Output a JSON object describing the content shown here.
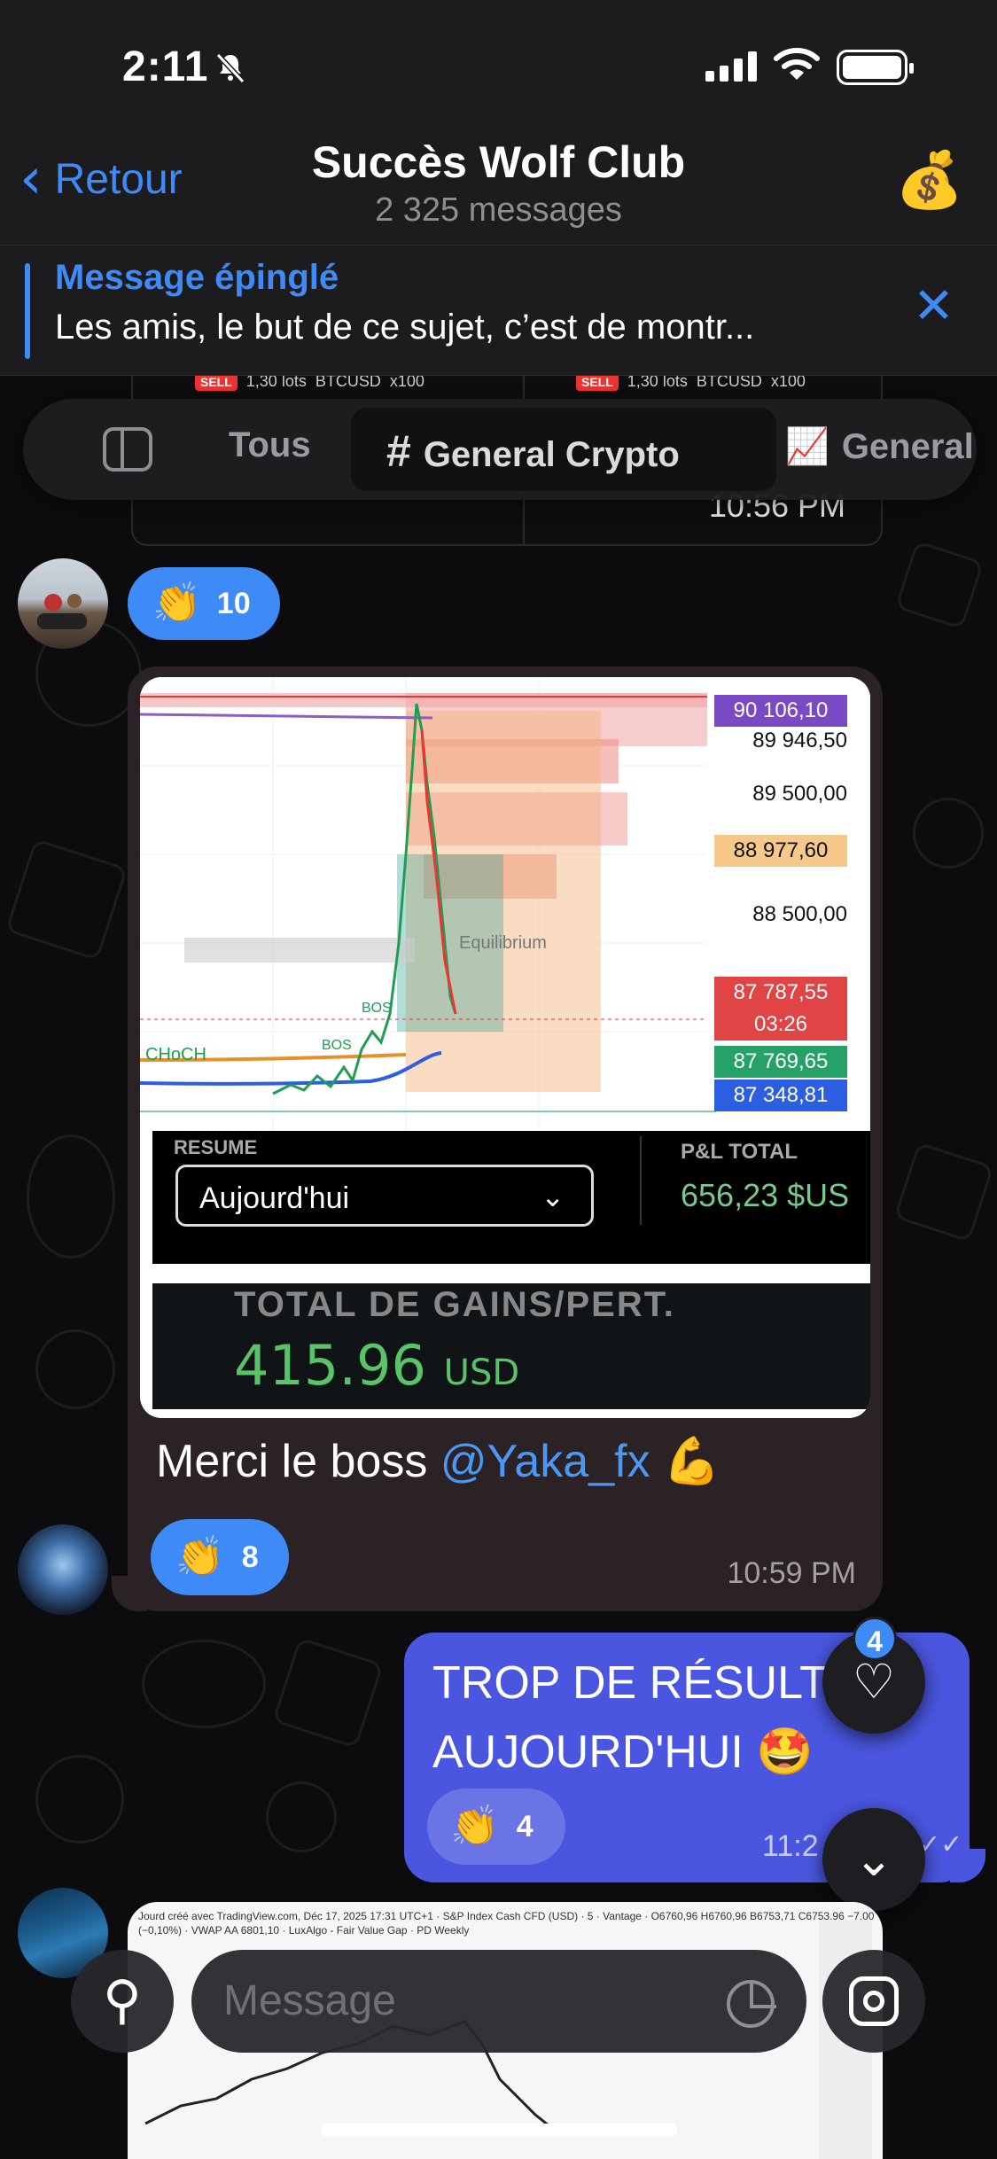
{
  "status": {
    "time": "2:11"
  },
  "header": {
    "back_label": "Retour",
    "title": "Succès Wolf Club",
    "subtitle": "2 325 messages",
    "avatar_icon": "money-bag-icon"
  },
  "pinned": {
    "title": "Message épinglé",
    "text": "Les amis, le but de ce sujet, c’est de montr..."
  },
  "top_strip": {
    "sell_badge": "SELL",
    "lots": "1,30 lots",
    "symbol": "BTCUSD",
    "leverage": "x100",
    "time": "10:56 PM"
  },
  "topics": {
    "items": [
      {
        "label": "Tous",
        "icon": "sidebar-icon"
      },
      {
        "label": "General Crypto",
        "icon": "hash-icon"
      },
      {
        "label": "General",
        "icon": "chart-emoji-icon"
      }
    ]
  },
  "message1": {
    "reaction": {
      "emoji": "👏",
      "count": "10"
    }
  },
  "message2": {
    "chart": {
      "prices": [
        "90 106,10",
        "89 946,50",
        "89 500,00",
        "88 977,60",
        "88 500,00",
        "87 787,55",
        "03:26",
        "87 769,65",
        "87 348,81"
      ],
      "labels": {
        "bos1": "BOS",
        "bos2": "BOS",
        "choch": "CHoCH",
        "equilibrium": "Equilibrium"
      }
    },
    "resume": {
      "label": "RESUME",
      "select_value": "Aujourd'hui",
      "pnl_label": "P&L TOTAL",
      "pnl_value": "656,23 $US"
    },
    "gains": {
      "label": "TOTAL DE GAINS/PERT.",
      "value": "415.96",
      "unit": "USD"
    },
    "caption_text": "Merci le boss ",
    "caption_mention": "@Yaka_fx",
    "caption_emoji": "💪",
    "reaction": {
      "emoji": "👏",
      "count": "8"
    },
    "time": "10:59 PM"
  },
  "message3": {
    "text": "TROP DE RÉSULTATS AUJOURD'HUI 🤩",
    "reaction": {
      "emoji": "👏",
      "count": "4"
    },
    "time": "11:2"
  },
  "fabs": {
    "reactions_badge": "4"
  },
  "message4": {
    "header_text": "Jourd créé avec TradingView.com, Déc 17, 2025 17:31 UTC+1 · S&P Index Cash CFD (USD) · 5 · Vantage · O6760,96 H6760,96 B6753,71 C6753,96 −7,00 (−0,10%) · VWAP AA 6801,10 · LuxAlgo - Fair Value Gap · PD Weekly"
  },
  "composer": {
    "placeholder": "Message"
  },
  "colors": {
    "accent": "#3e8af7",
    "outgoing": "#4a56df",
    "incoming": "#2a2224",
    "profit": "#59c36a"
  }
}
